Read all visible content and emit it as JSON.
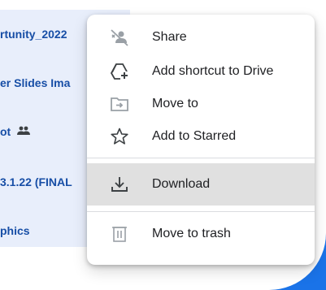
{
  "files": [
    {
      "name": "rtunity_2022",
      "shared": false
    },
    {
      "name": "er Slides Ima",
      "shared": false
    },
    {
      "name": "ot",
      "shared": true
    },
    {
      "name": "3.1.22 (FINAL",
      "shared": false
    },
    {
      "name": "phics",
      "shared": false
    }
  ],
  "menu": {
    "items": [
      {
        "label": "Share",
        "icon": "share-off-icon"
      },
      {
        "label": "Add shortcut to Drive",
        "icon": "add-shortcut-icon"
      },
      {
        "label": "Move to",
        "icon": "move-to-folder-icon"
      },
      {
        "label": "Add to Starred",
        "icon": "star-outline-icon"
      },
      {
        "label": "Download",
        "icon": "download-icon"
      },
      {
        "label": "Move to trash",
        "icon": "trash-icon"
      }
    ]
  },
  "colors": {
    "accent": "#1a73e8",
    "file_text": "#174ea6",
    "highlight": "#e0e0e0"
  }
}
